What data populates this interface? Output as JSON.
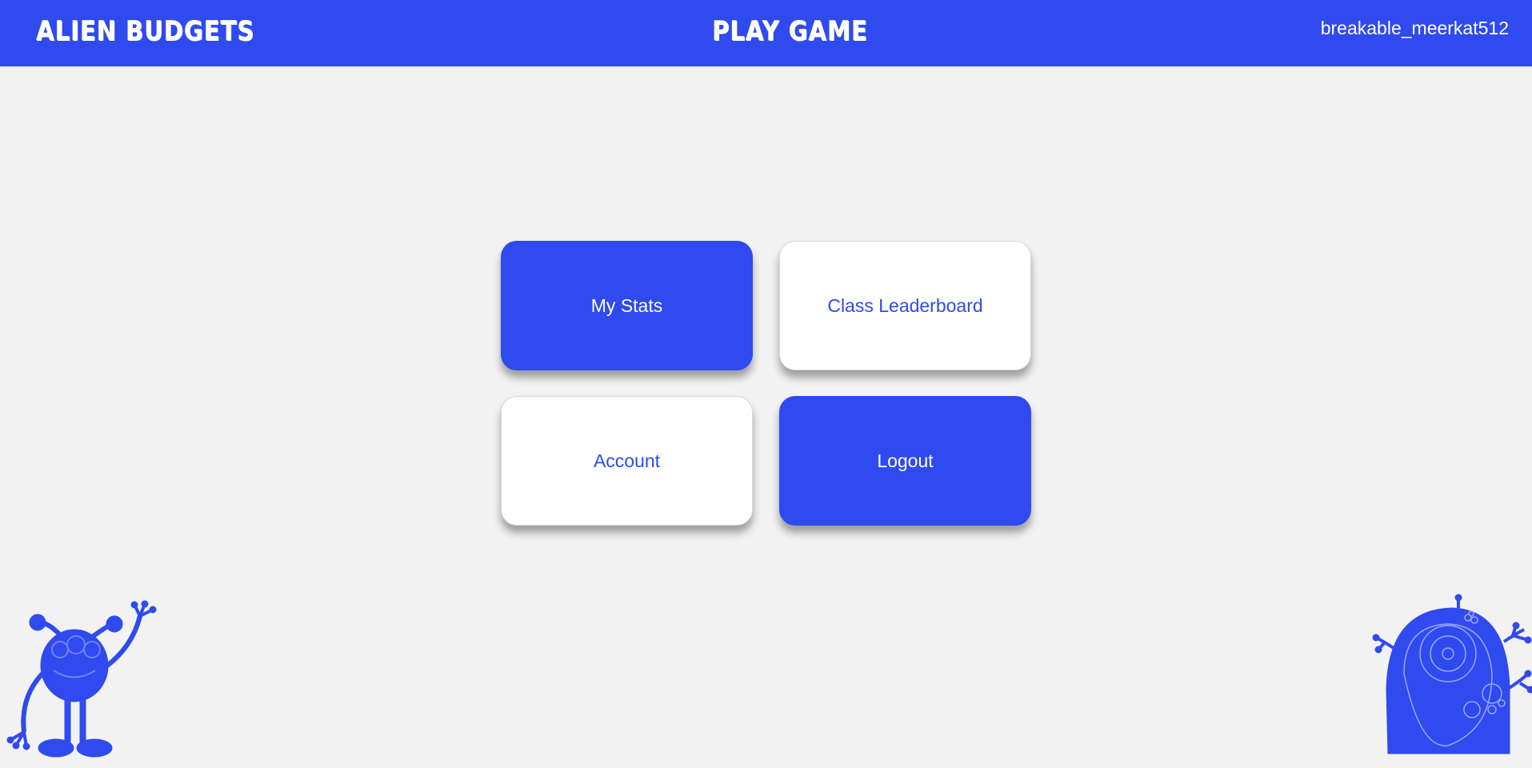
{
  "header": {
    "brand": "ALIEN BUDGETS",
    "play_game": "PLAY GAME",
    "username": "breakable_meerkat512"
  },
  "menu": {
    "tiles": [
      {
        "label": "My Stats",
        "style": "filled"
      },
      {
        "label": "Class Leaderboard",
        "style": "outlined"
      },
      {
        "label": "Account",
        "style": "outlined"
      },
      {
        "label": "Logout",
        "style": "filled"
      }
    ]
  },
  "decorations": {
    "left_icon": "waving-alien-icon",
    "right_icon": "blob-alien-icon"
  },
  "colors": {
    "brand_blue": "#2f4aef",
    "background": "#f2f2f2",
    "tile_white": "#ffffff"
  }
}
